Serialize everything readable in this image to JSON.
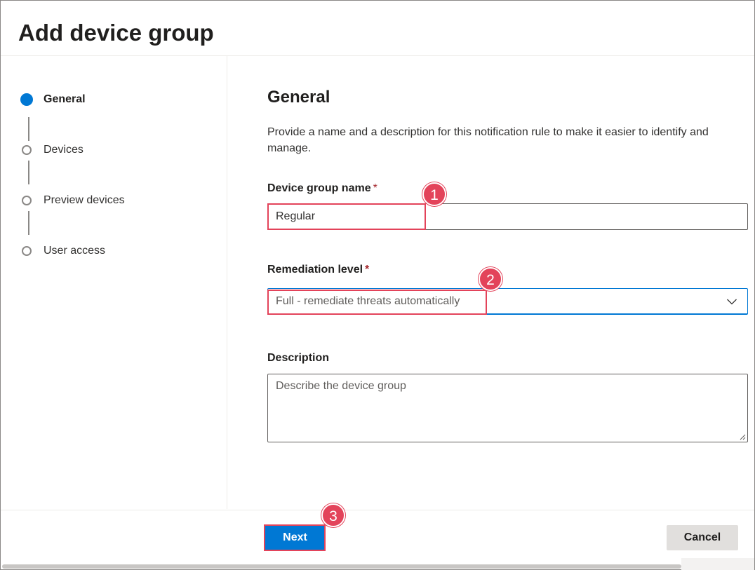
{
  "dialog": {
    "title": "Add device group"
  },
  "steps": [
    {
      "label": "General",
      "active": true
    },
    {
      "label": "Devices",
      "active": false
    },
    {
      "label": "Preview devices",
      "active": false
    },
    {
      "label": "User access",
      "active": false
    }
  ],
  "general": {
    "title": "General",
    "description": "Provide a name and a description for this notification rule to make it easier to identify and manage.",
    "name_field": {
      "label": "Device group name",
      "required_mark": "*",
      "value": "Regular"
    },
    "remediation_field": {
      "label": "Remediation level",
      "required_mark": "*",
      "value": "Full - remediate threats automatically",
      "icon": "chevron-down-icon"
    },
    "description_field": {
      "label": "Description",
      "placeholder": "Describe the device group"
    }
  },
  "footer": {
    "next_label": "Next",
    "cancel_label": "Cancel"
  },
  "annotations": [
    "1",
    "2",
    "3"
  ],
  "colors": {
    "accent": "#0078d4",
    "highlight": "#e3435a",
    "required": "#a4262c"
  }
}
